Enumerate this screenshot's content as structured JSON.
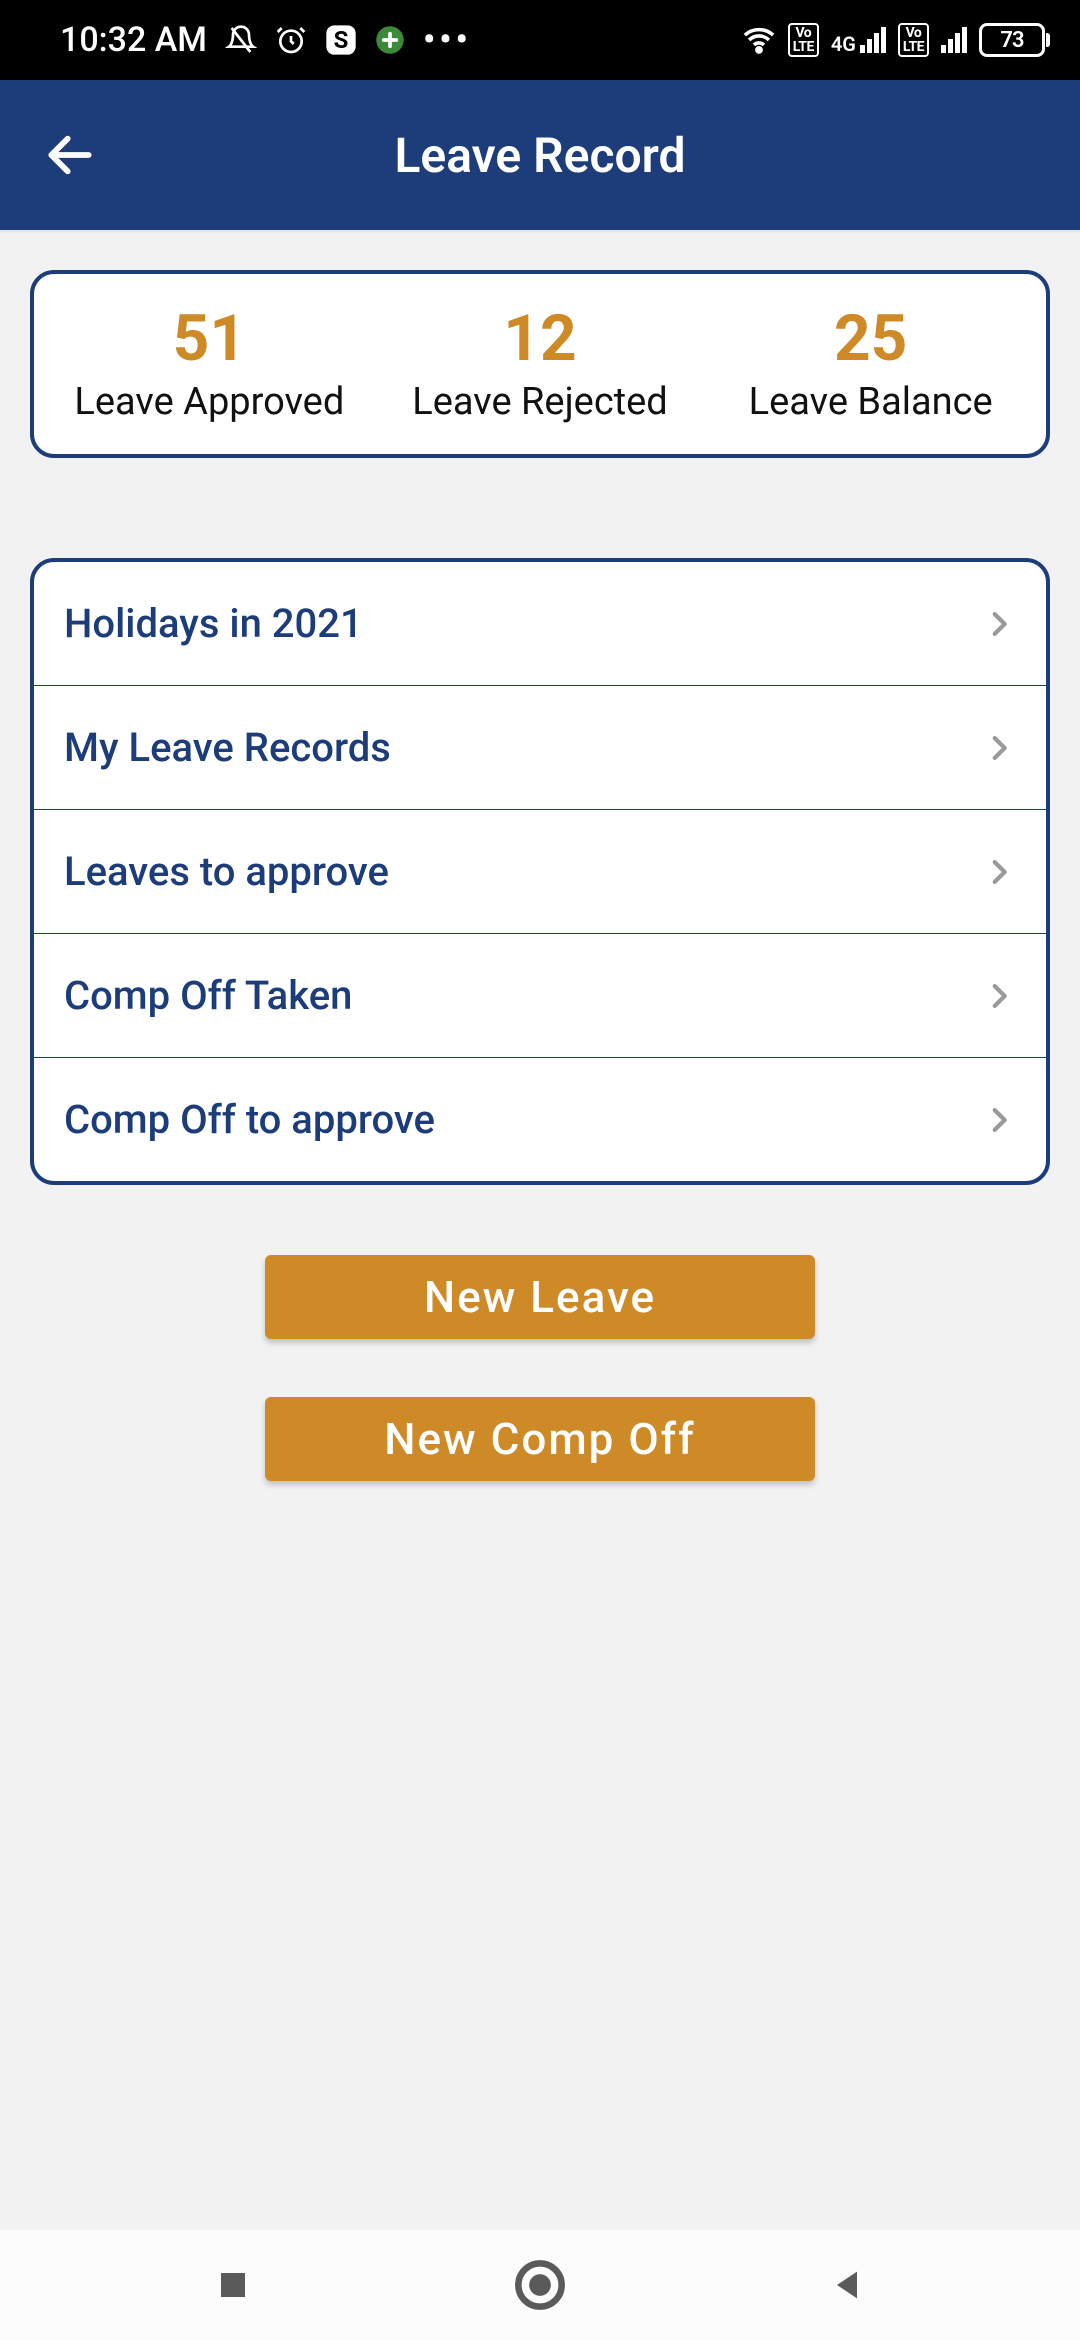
{
  "status_bar": {
    "time": "10:32 AM",
    "network_label": "4G",
    "lte_label": "Vo\nLTE",
    "battery_percent": "73",
    "icons": {
      "bell_mute": "bell-mute-icon",
      "alarm": "alarm-icon",
      "skype": "skype-icon",
      "app": "app-icon",
      "more": "•••",
      "wifi": "wifi-icon"
    }
  },
  "header": {
    "title": "Leave Record"
  },
  "summary": {
    "approved": {
      "value": "51",
      "label": "Leave Approved"
    },
    "rejected": {
      "value": "12",
      "label": "Leave Rejected"
    },
    "balance": {
      "value": "25",
      "label": "Leave Balance"
    }
  },
  "nav": [
    {
      "label": "Holidays in 2021"
    },
    {
      "label": "My Leave Records"
    },
    {
      "label": "Leaves to approve"
    },
    {
      "label": "Comp Off Taken"
    },
    {
      "label": "Comp Off to approve"
    }
  ],
  "buttons": {
    "new_leave": "New Leave",
    "new_comp_off": "New Comp Off"
  },
  "colors": {
    "brand": "#1c3d7a",
    "accent": "#cf8a28"
  }
}
